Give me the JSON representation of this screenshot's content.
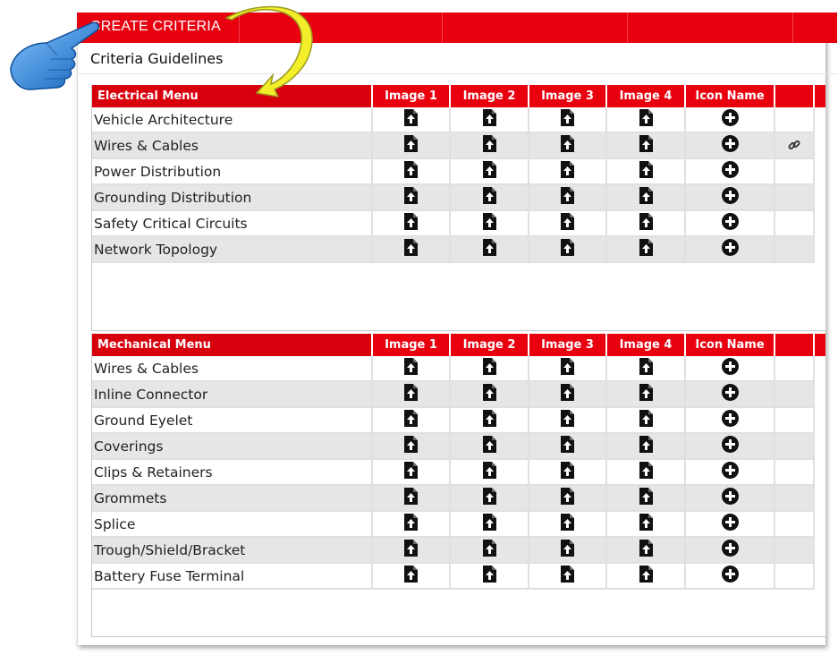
{
  "header": {
    "title": "CREATE CRITERIA",
    "subtitle": "Criteria Guidelines"
  },
  "colors": {
    "brand_red": "#e8000f",
    "row_alt": "#e6e6e6",
    "pointer_blue": "#2a7fd4",
    "arrow_yellow": "#f2ee2a"
  },
  "icons": {
    "upload": "file-upload-icon",
    "add": "plus-circle-icon",
    "link": "link-icon",
    "pointer": "pointing-hand-icon",
    "arrow": "curved-arrow-icon"
  },
  "electrical": {
    "columns": [
      "Electrical Menu",
      "Image 1",
      "Image 2",
      "Image 3",
      "Image 4",
      "Icon Name",
      ""
    ],
    "rows": [
      {
        "name": "Vehicle Architecture",
        "has_link": false
      },
      {
        "name": "Wires & Cables",
        "has_link": true
      },
      {
        "name": "Power Distribution",
        "has_link": false
      },
      {
        "name": "Grounding Distribution",
        "has_link": false
      },
      {
        "name": "Safety Critical Circuits",
        "has_link": false
      },
      {
        "name": "Network Topology",
        "has_link": false
      }
    ]
  },
  "mechanical": {
    "columns": [
      "Mechanical Menu",
      "Image 1",
      "Image 2",
      "Image 3",
      "Image 4",
      "Icon Name",
      ""
    ],
    "rows": [
      {
        "name": "Wires & Cables",
        "has_link": false
      },
      {
        "name": "Inline Connector",
        "has_link": false
      },
      {
        "name": "Ground Eyelet",
        "has_link": false
      },
      {
        "name": "Coverings",
        "has_link": false
      },
      {
        "name": "Clips & Retainers",
        "has_link": false
      },
      {
        "name": "Grommets",
        "has_link": false
      },
      {
        "name": "Splice",
        "has_link": false
      },
      {
        "name": "Trough/Shield/Bracket",
        "has_link": false
      },
      {
        "name": "Battery Fuse Terminal",
        "has_link": false
      }
    ]
  }
}
